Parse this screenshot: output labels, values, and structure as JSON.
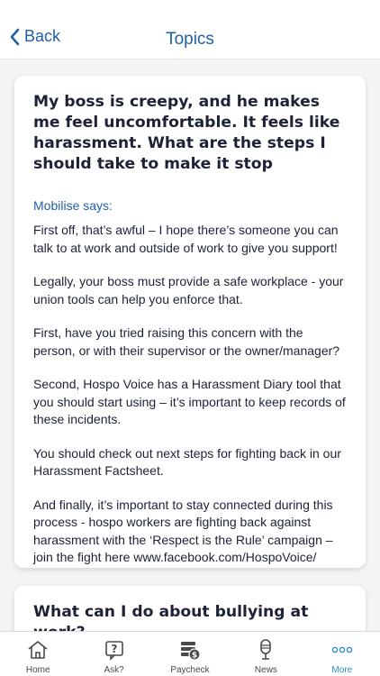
{
  "header": {
    "back_label": "Back",
    "title": "Topics"
  },
  "cards": [
    {
      "question": "My boss is creepy, and he makes me feel uncomfortable. It feels like harassment. What are the steps I should take to make it stop",
      "says": "Mobilise says:",
      "paragraphs": [
        "First off, that’s awful – I hope there’s someone you can talk to at work and outside of work to give you support!",
        "Legally, your boss must provide a safe workplace - your union tools can help you enforce that.",
        "First, have you tried raising this concern with the person, or with their supervisor or the owner/manager?",
        "Second, Hospo Voice has a Harassment Diary tool that you should start using – it’s important to keep records of these incidents.",
        "You should check out next steps for fighting back in our Harassment Factsheet.",
        "And finally, it’s important to stay connected during this process - hospo workers are fighting back against harassment with the ‘Respect is the Rule’ campaign – join the fight here www.facebook.com/HospoVoice/"
      ]
    },
    {
      "question": "What can I do about bullying at work?"
    }
  ],
  "tabbar": [
    {
      "label": "Home",
      "icon": "home-icon"
    },
    {
      "label": "Ask?",
      "icon": "question-icon"
    },
    {
      "label": "Paycheck",
      "icon": "paycheck-icon"
    },
    {
      "label": "News",
      "icon": "microphone-icon"
    },
    {
      "label": "More",
      "icon": "more-icon",
      "active": true
    }
  ],
  "colors": {
    "accent": "#1f5fa8",
    "active_tab": "#2f8fcf",
    "text": "#1d2236"
  }
}
